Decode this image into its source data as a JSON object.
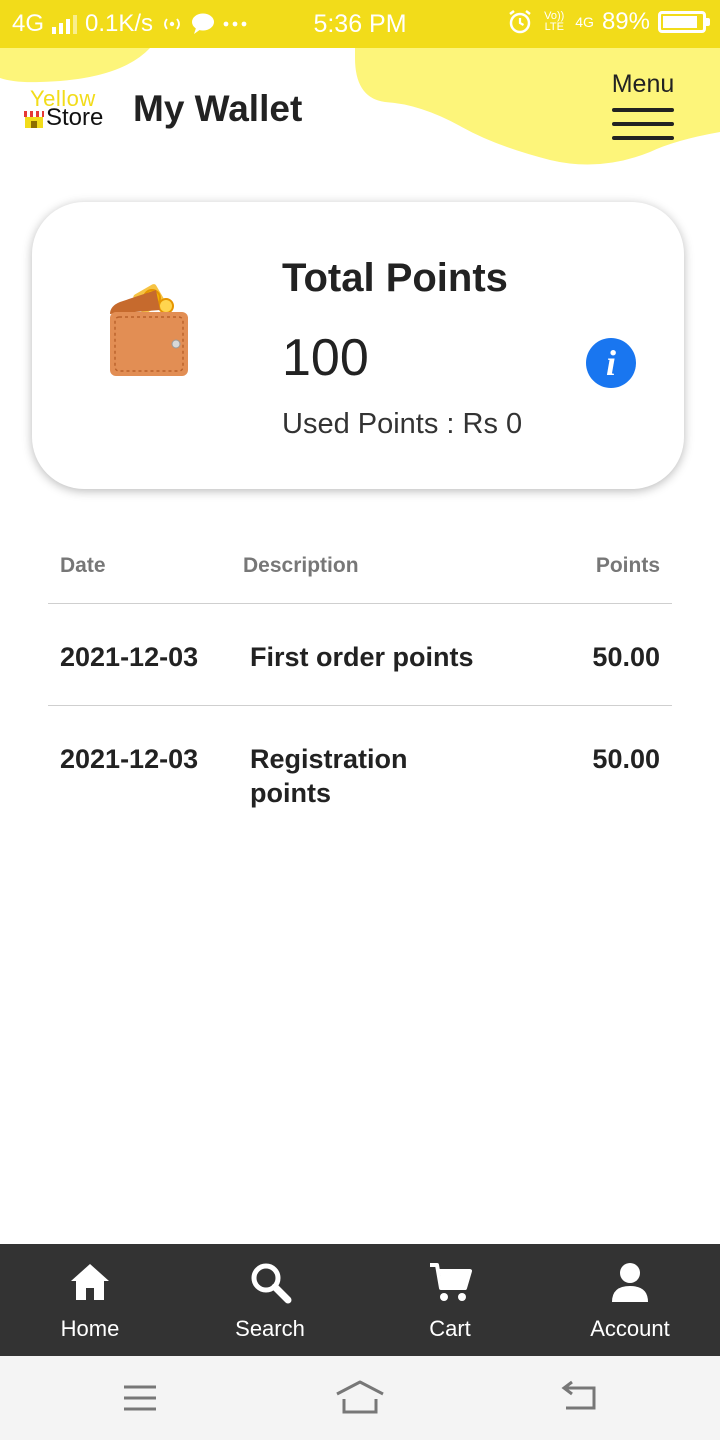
{
  "status_bar": {
    "network": "4G",
    "speed": "0.1K/s",
    "time": "5:36 PM",
    "volte": "Vo)) LTE",
    "network_right": "4G",
    "battery": "89%",
    "battery_level": 0.89
  },
  "header": {
    "logo_top": "Yellow",
    "logo_bottom": "Store",
    "title": "My Wallet",
    "menu_label": "Menu",
    "accent_color": "#f2dc1a",
    "blob_color": "#fdf57a"
  },
  "points_card": {
    "title": "Total Points",
    "total": "100",
    "used": "Used Points : Rs 0",
    "wallet_icon": "wallet-icon",
    "info_icon": "info-icon",
    "info_color": "#1976f0"
  },
  "table": {
    "headers": {
      "date": "Date",
      "description": "Description",
      "points": "Points"
    },
    "rows": [
      {
        "date": "2021-12-03",
        "description": "First order points",
        "points": "50.00"
      },
      {
        "date": "2021-12-03",
        "description_line1": "Registration",
        "description_line2": "points",
        "points": "50.00"
      }
    ]
  },
  "bottom_nav": {
    "items": [
      {
        "label": "Home",
        "icon": "home-icon"
      },
      {
        "label": "Search",
        "icon": "search-icon"
      },
      {
        "label": "Cart",
        "icon": "cart-icon"
      },
      {
        "label": "Account",
        "icon": "account-icon"
      }
    ],
    "background": "#333333"
  },
  "system_nav": {
    "icons": [
      "recent-apps-icon",
      "home-nav-icon",
      "back-icon"
    ]
  }
}
